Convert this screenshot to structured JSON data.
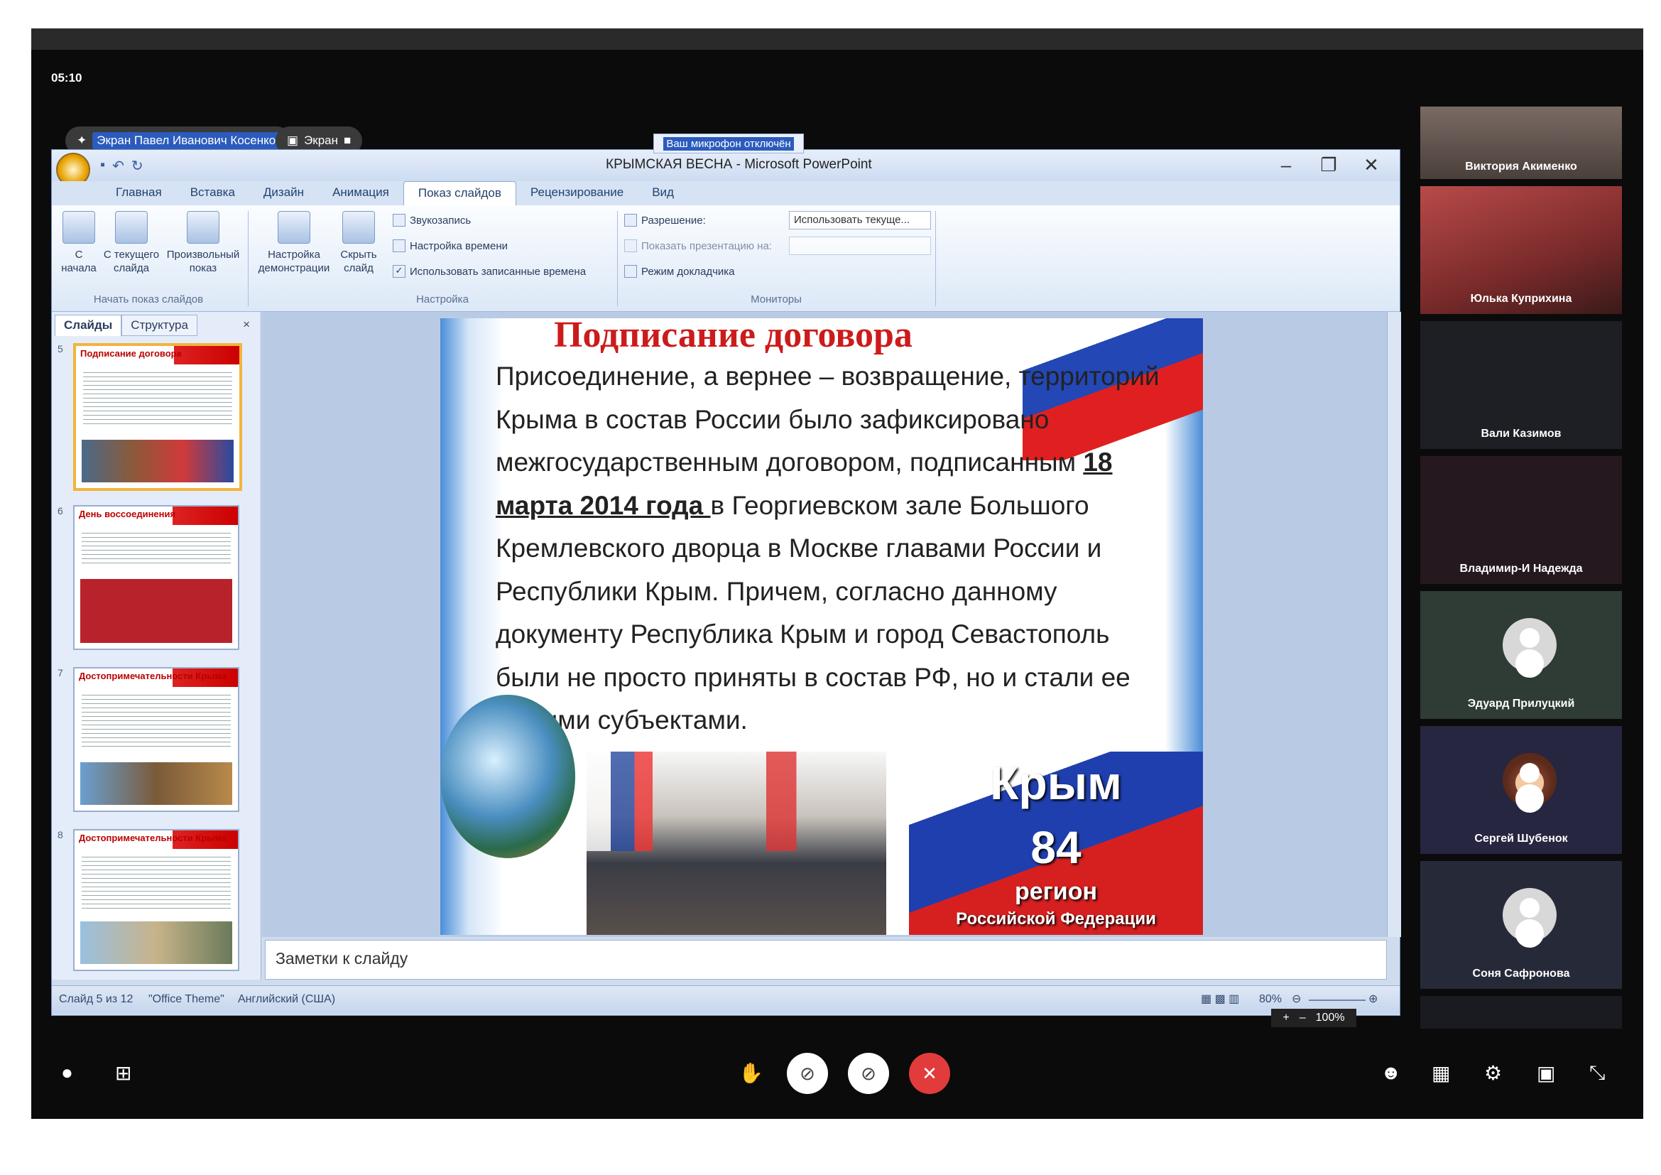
{
  "meeting": {
    "timer": "05:10",
    "presenter_chip": "Экран Павел Иванович Косенко",
    "screen_chip": "Экран",
    "mic_toast": "Ваш микрофон отключён",
    "zoom_level": "100%"
  },
  "powerpoint": {
    "window_title": "КРЫМСКАЯ ВЕСНА - Microsoft PowerPoint",
    "tabs": [
      "Главная",
      "Вставка",
      "Дизайн",
      "Анимация",
      "Показ слайдов",
      "Рецензирование",
      "Вид"
    ],
    "active_tab": "Показ слайдов",
    "ribbon": {
      "from_start": "С начала",
      "from_current": "С текущего слайда",
      "custom_show": "Произвольный показ",
      "group_start": "Начать показ слайдов",
      "setup_show": "Настройка демонстрации",
      "hide_slide": "Скрыть слайд",
      "record_narration": "Звукозапись",
      "rehearse_timings": "Настройка времени",
      "use_timings": "Использовать записанные времена",
      "group_setup": "Настройка",
      "resolution_label": "Разрешение:",
      "resolution_value": "Использовать текуще...",
      "show_on_label": "Показать презентацию на:",
      "presenter_view": "Режим докладчика",
      "group_monitors": "Мониторы"
    },
    "left_panel": {
      "tab_slides": "Слайды",
      "tab_outline": "Структура",
      "thumbnails": [
        {
          "num": "5",
          "title": "Подписание договора"
        },
        {
          "num": "6",
          "title": "День воссоединения"
        },
        {
          "num": "7",
          "title": "Достопримечательности Крыма"
        },
        {
          "num": "8",
          "title": "Достопримечательности Крыма"
        }
      ]
    },
    "slide": {
      "title": "Подписание договора",
      "body_before": "Присоединение, а вернее – возвращение, территорий  Крыма в состав России было зафиксировано межгосударственным договором, подписанным ",
      "body_date": "18 марта 2014 года ",
      "body_after": "в Георгиевском зале Большого Кремлевского дворца в Москве главами России и Республики Крым. Причем, согласно данному документу Республика Крым и город Севастополь были не просто приняты в состав РФ, но и стали ее новыми субъектами.",
      "crimea_title": "Крым",
      "crimea_number": "84",
      "crimea_region": "регион",
      "crimea_federation": "Российской Федерации"
    },
    "notes_placeholder": "Заметки к слайду",
    "status": {
      "slide_counter": "Слайд 5 из 12",
      "theme": "\"Office Theme\"",
      "language": "Английский (США)",
      "zoom": "80%"
    }
  },
  "participants": [
    "Виктория Акименко",
    "Юлька Куприхина",
    "Вали Казимов",
    "Владимир-И Надежда",
    "Эдуард Прилуцкий",
    "Сергей Шубенок",
    "Соня Сафронова"
  ]
}
